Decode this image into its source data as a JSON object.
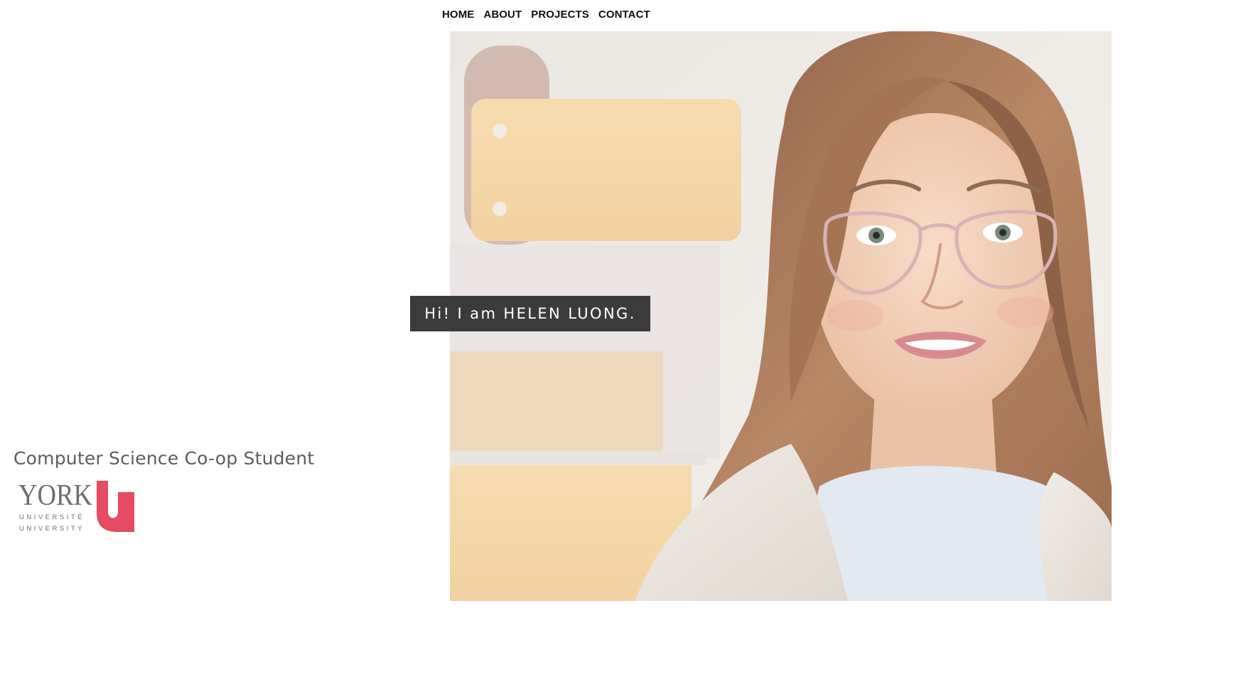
{
  "nav": {
    "items": [
      {
        "label": "HOME",
        "name": "nav-home"
      },
      {
        "label": "ABOUT",
        "name": "nav-about"
      },
      {
        "label": "PROJECTS",
        "name": "nav-projects"
      },
      {
        "label": "CONTACT",
        "name": "nav-contact"
      }
    ]
  },
  "hero": {
    "greeting": "Hi! I am HELEN LUONG.",
    "subtitle": "Computer Science Co-op Student"
  },
  "logo": {
    "word": "YORK",
    "letter": "U",
    "line1": "UNIVERSITÉ",
    "line2": "UNIVERSITY",
    "accent_color": "#e31837",
    "text_color": "#6d6d6d"
  },
  "colors": {
    "greeting_bg": "#3b3b3b",
    "greeting_text": "#ffffff",
    "subtitle_text": "#5d5d5d",
    "nav_text": "#111111"
  }
}
